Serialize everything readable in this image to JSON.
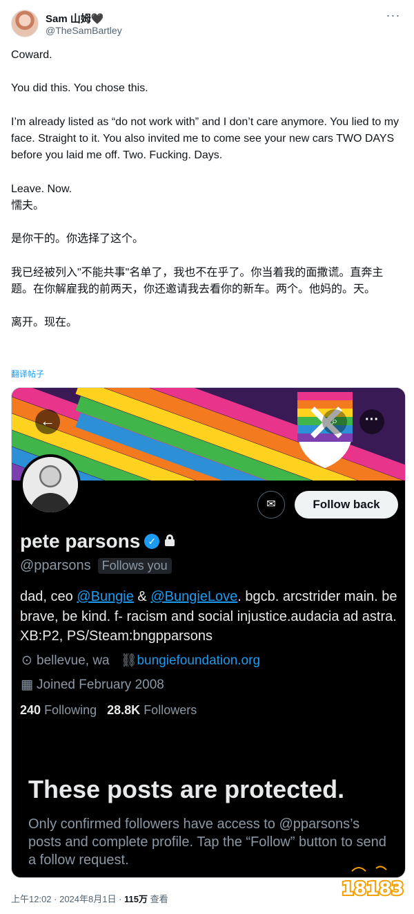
{
  "author": {
    "name": "Sam 山姆🖤",
    "handle": "@TheSamBartley",
    "more": "···"
  },
  "tweet": {
    "paragraphs": [
      "Coward.",
      "You did this. You chose this.",
      "I’m already listed as “do not work with” and I don’t care anymore. You lied to my face. Straight to it. You also invited me to come see your new cars TWO DAYS before you laid me off. Two. Fucking. Days.",
      "Leave. Now.",
      "懦夫。",
      "是你干的。你选择了这个。",
      "我已经被列入\"不能共事\"名单了，我也不在乎了。你当着我的面撒谎。直奔主题。在你解雇我的前两天，你还邀请我去看你的新车。两个。他妈的。天。",
      "离开。现在。"
    ],
    "translate_link": "翻译帖子"
  },
  "screenshot": {
    "back_label": "←",
    "search_label": "⌕",
    "more_label": "···",
    "message_label": "✉",
    "follow_back_label": "Follow back",
    "name": "pete parsons",
    "verified_mark": "✓",
    "handle": "@pparsons",
    "follows_you": "Follows you",
    "bio_1": "dad, ceo ",
    "mention_1": "@Bungie",
    "bio_2": " & ",
    "mention_2": "@BungieLove",
    "bio_3": ". bgcb. arcstrider main. be brave, be kind. f- racism and social injustice.audacia ad astra. XB:P2, PS/Steam:bngpparsons",
    "location_icon": "⊙",
    "location": "bellevue, wa",
    "link_icon": "⛓",
    "website": "bungiefoundation.org",
    "calendar_icon": "▦",
    "joined": "Joined February 2008",
    "following_count": "240",
    "following_label": "Following",
    "followers_count": "28.8K",
    "followers_label": "Followers",
    "protected_title": "These posts are protected.",
    "protected_desc": "Only confirmed followers have access to @pparsons’s posts and complete profile. Tap the “Follow” button to send a follow request."
  },
  "footer": {
    "time": "上午12:02 · 2024年8月1日 · ",
    "views_count": "115万",
    "views_label": " 查看"
  },
  "watermark": {
    "text": "18183"
  },
  "colors": {
    "link": "#1d9bf0",
    "verified": "#1d9bf0",
    "dark_bg": "#000000"
  }
}
